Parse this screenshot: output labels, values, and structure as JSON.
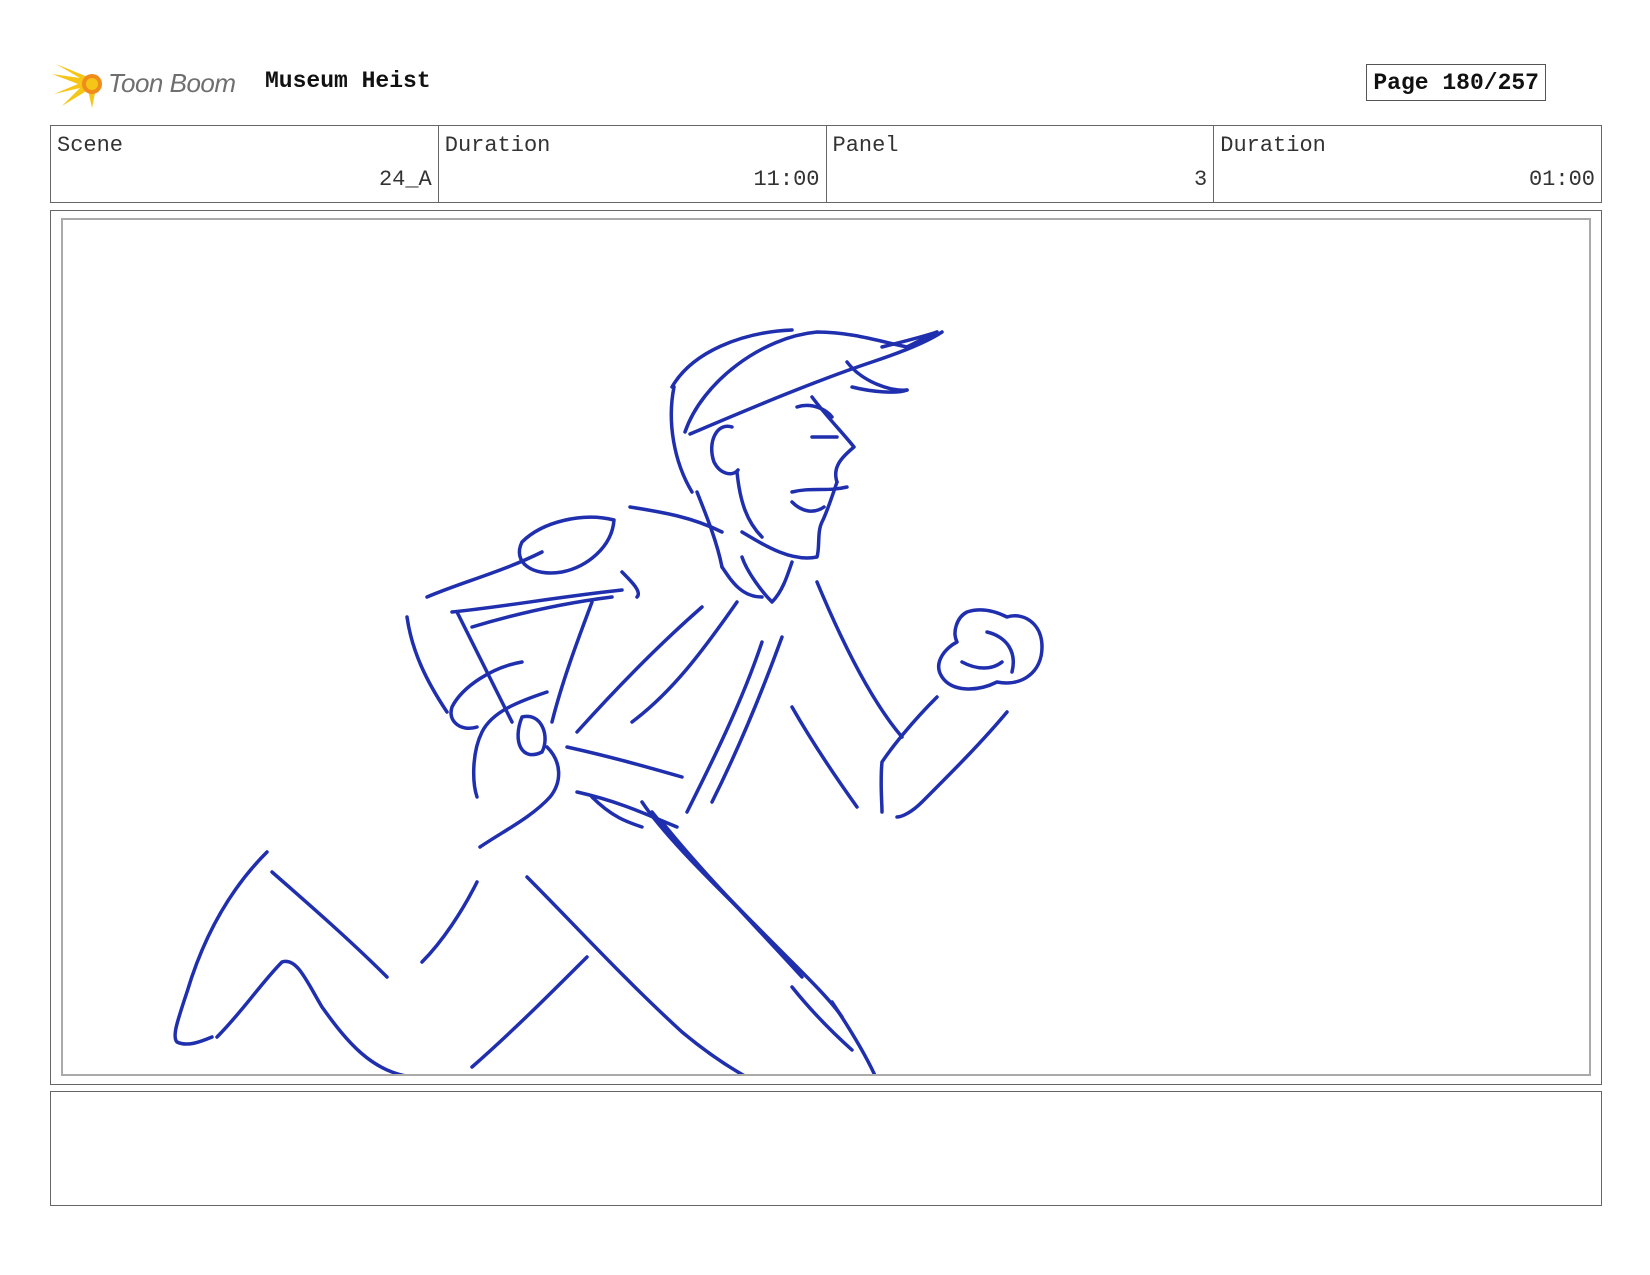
{
  "header": {
    "logo_text": "Toon Boom",
    "project_title": "Museum Heist",
    "page_label": "Page 180/257"
  },
  "info": {
    "scene": {
      "label": "Scene",
      "value": "24_A"
    },
    "scene_duration": {
      "label": "Duration",
      "value": "11:00"
    },
    "panel": {
      "label": "Panel",
      "value": "3"
    },
    "panel_duration": {
      "label": "Duration",
      "value": "01:00"
    }
  },
  "colors": {
    "sketch_stroke": "#1f2fae",
    "logo_yellow": "#f5c518",
    "logo_orange": "#f08c1c"
  },
  "notes": {
    "text": ""
  }
}
